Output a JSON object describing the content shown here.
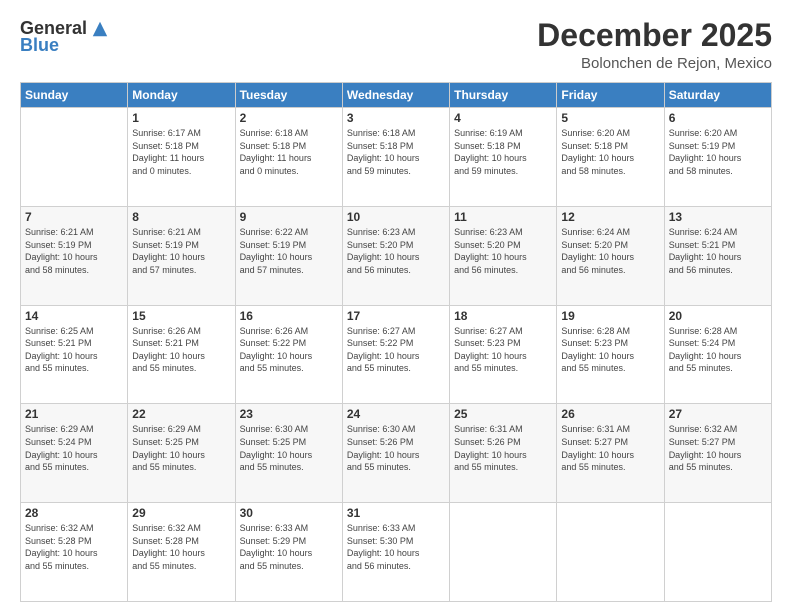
{
  "header": {
    "logo_general": "General",
    "logo_blue": "Blue",
    "month_title": "December 2025",
    "location": "Bolonchen de Rejon, Mexico"
  },
  "columns": [
    "Sunday",
    "Monday",
    "Tuesday",
    "Wednesday",
    "Thursday",
    "Friday",
    "Saturday"
  ],
  "weeks": [
    [
      {
        "day": "",
        "info": ""
      },
      {
        "day": "1",
        "info": "Sunrise: 6:17 AM\nSunset: 5:18 PM\nDaylight: 11 hours\nand 0 minutes."
      },
      {
        "day": "2",
        "info": "Sunrise: 6:18 AM\nSunset: 5:18 PM\nDaylight: 11 hours\nand 0 minutes."
      },
      {
        "day": "3",
        "info": "Sunrise: 6:18 AM\nSunset: 5:18 PM\nDaylight: 10 hours\nand 59 minutes."
      },
      {
        "day": "4",
        "info": "Sunrise: 6:19 AM\nSunset: 5:18 PM\nDaylight: 10 hours\nand 59 minutes."
      },
      {
        "day": "5",
        "info": "Sunrise: 6:20 AM\nSunset: 5:18 PM\nDaylight: 10 hours\nand 58 minutes."
      },
      {
        "day": "6",
        "info": "Sunrise: 6:20 AM\nSunset: 5:19 PM\nDaylight: 10 hours\nand 58 minutes."
      }
    ],
    [
      {
        "day": "7",
        "info": "Sunrise: 6:21 AM\nSunset: 5:19 PM\nDaylight: 10 hours\nand 58 minutes."
      },
      {
        "day": "8",
        "info": "Sunrise: 6:21 AM\nSunset: 5:19 PM\nDaylight: 10 hours\nand 57 minutes."
      },
      {
        "day": "9",
        "info": "Sunrise: 6:22 AM\nSunset: 5:19 PM\nDaylight: 10 hours\nand 57 minutes."
      },
      {
        "day": "10",
        "info": "Sunrise: 6:23 AM\nSunset: 5:20 PM\nDaylight: 10 hours\nand 56 minutes."
      },
      {
        "day": "11",
        "info": "Sunrise: 6:23 AM\nSunset: 5:20 PM\nDaylight: 10 hours\nand 56 minutes."
      },
      {
        "day": "12",
        "info": "Sunrise: 6:24 AM\nSunset: 5:20 PM\nDaylight: 10 hours\nand 56 minutes."
      },
      {
        "day": "13",
        "info": "Sunrise: 6:24 AM\nSunset: 5:21 PM\nDaylight: 10 hours\nand 56 minutes."
      }
    ],
    [
      {
        "day": "14",
        "info": "Sunrise: 6:25 AM\nSunset: 5:21 PM\nDaylight: 10 hours\nand 55 minutes."
      },
      {
        "day": "15",
        "info": "Sunrise: 6:26 AM\nSunset: 5:21 PM\nDaylight: 10 hours\nand 55 minutes."
      },
      {
        "day": "16",
        "info": "Sunrise: 6:26 AM\nSunset: 5:22 PM\nDaylight: 10 hours\nand 55 minutes."
      },
      {
        "day": "17",
        "info": "Sunrise: 6:27 AM\nSunset: 5:22 PM\nDaylight: 10 hours\nand 55 minutes."
      },
      {
        "day": "18",
        "info": "Sunrise: 6:27 AM\nSunset: 5:23 PM\nDaylight: 10 hours\nand 55 minutes."
      },
      {
        "day": "19",
        "info": "Sunrise: 6:28 AM\nSunset: 5:23 PM\nDaylight: 10 hours\nand 55 minutes."
      },
      {
        "day": "20",
        "info": "Sunrise: 6:28 AM\nSunset: 5:24 PM\nDaylight: 10 hours\nand 55 minutes."
      }
    ],
    [
      {
        "day": "21",
        "info": "Sunrise: 6:29 AM\nSunset: 5:24 PM\nDaylight: 10 hours\nand 55 minutes."
      },
      {
        "day": "22",
        "info": "Sunrise: 6:29 AM\nSunset: 5:25 PM\nDaylight: 10 hours\nand 55 minutes."
      },
      {
        "day": "23",
        "info": "Sunrise: 6:30 AM\nSunset: 5:25 PM\nDaylight: 10 hours\nand 55 minutes."
      },
      {
        "day": "24",
        "info": "Sunrise: 6:30 AM\nSunset: 5:26 PM\nDaylight: 10 hours\nand 55 minutes."
      },
      {
        "day": "25",
        "info": "Sunrise: 6:31 AM\nSunset: 5:26 PM\nDaylight: 10 hours\nand 55 minutes."
      },
      {
        "day": "26",
        "info": "Sunrise: 6:31 AM\nSunset: 5:27 PM\nDaylight: 10 hours\nand 55 minutes."
      },
      {
        "day": "27",
        "info": "Sunrise: 6:32 AM\nSunset: 5:27 PM\nDaylight: 10 hours\nand 55 minutes."
      }
    ],
    [
      {
        "day": "28",
        "info": "Sunrise: 6:32 AM\nSunset: 5:28 PM\nDaylight: 10 hours\nand 55 minutes."
      },
      {
        "day": "29",
        "info": "Sunrise: 6:32 AM\nSunset: 5:28 PM\nDaylight: 10 hours\nand 55 minutes."
      },
      {
        "day": "30",
        "info": "Sunrise: 6:33 AM\nSunset: 5:29 PM\nDaylight: 10 hours\nand 55 minutes."
      },
      {
        "day": "31",
        "info": "Sunrise: 6:33 AM\nSunset: 5:30 PM\nDaylight: 10 hours\nand 56 minutes."
      },
      {
        "day": "",
        "info": ""
      },
      {
        "day": "",
        "info": ""
      },
      {
        "day": "",
        "info": ""
      }
    ]
  ]
}
